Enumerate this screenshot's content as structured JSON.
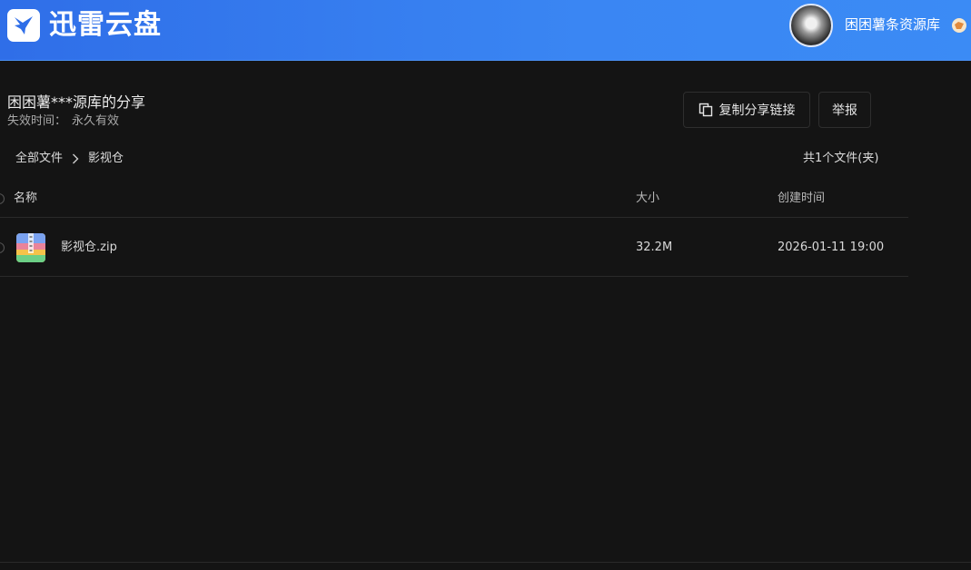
{
  "header": {
    "brand": "迅雷云盘",
    "username": "困困薯条资源库"
  },
  "share": {
    "title": "困困薯***源库的分享",
    "expire_label": "失效时间：",
    "expire_value": "永久有效",
    "copy_link_label": "复制分享链接",
    "report_label": "举报"
  },
  "breadcrumb": {
    "root": "全部文件",
    "current": "影视仓"
  },
  "file_count": "共1个文件(夹)",
  "table": {
    "columns": {
      "name": "名称",
      "size": "大小",
      "created": "创建时间"
    },
    "rows": [
      {
        "icon": "zip-file-icon",
        "name": "影视仓.zip",
        "size": "32.2M",
        "created": "2026-01-11 19:00"
      }
    ]
  },
  "colors": {
    "header_blue": "#3a86f3",
    "background": "#141414"
  }
}
